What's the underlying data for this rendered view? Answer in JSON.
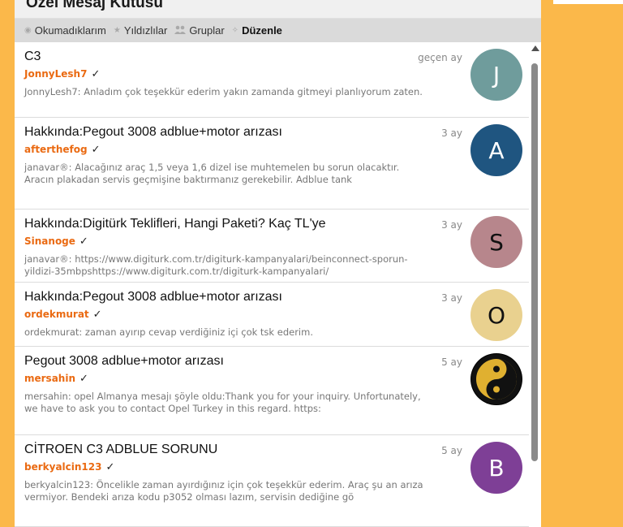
{
  "title": "Özel Mesaj Kutusu",
  "tabs": [
    {
      "label": "Okumadıklarım",
      "icon": "eye-icon"
    },
    {
      "label": "Yıldızlılar",
      "icon": "star-icon"
    },
    {
      "label": "Gruplar",
      "icon": "users-icon"
    },
    {
      "label": "Düzenle",
      "icon": "settings-icon",
      "active": true
    }
  ],
  "messages": [
    {
      "subject": "C3",
      "user": "JonnyLesh7",
      "preview": "JonnyLesh7: Anladım çok teşekkür ederim yakın zamanda gitmeyi planlıyorum zaten.",
      "time": "geçen ay",
      "avatar_letter": "J",
      "avatar_color": "#6f9c9c"
    },
    {
      "subject": "Hakkında:Pegout 3008 adblue+motor arızası",
      "user": "afterthefog",
      "preview": "janavar®: Alacağınız araç 1,5 veya 1,6 dizel ise muhtemelen bu sorun olacaktır. Aracın plakadan servis geçmişine baktırmanız gerekebilir. Adblue tank",
      "time": "3 ay",
      "avatar_letter": "A",
      "avatar_color": "#1f5580"
    },
    {
      "subject": "Hakkında:Digitürk Teklifleri, Hangi Paketi? Kaç TL'ye",
      "user": "Sinanoge",
      "preview": "janavar®: https://www.digiturk.com.tr/digiturk-kampanyalari/beinconnect-sporun-yildizi-35mbpshttps://www.digiturk.com.tr/digiturk-kampanyalari/",
      "time": "3 ay",
      "avatar_letter": "S",
      "avatar_color": "#b7868c"
    },
    {
      "subject": "Hakkında:Pegout 3008 adblue+motor arızası",
      "user": "ordekmurat",
      "preview": "ordekmurat: zaman ayırıp cevap verdiğiniz içi çok tsk ederim.",
      "time": "3 ay",
      "avatar_letter": "O",
      "avatar_color": "#e9d18f"
    },
    {
      "subject": "Pegout 3008 adblue+motor arızası",
      "user": "mersahin",
      "preview": "mersahin: opel Almanya mesajı şöyle oldu:Thank you for your inquiry. Unfortunately, we have to ask you to contact Opel Turkey in this regard. https:",
      "time": "5 ay",
      "avatar_letter": "",
      "avatar_color": "#000000"
    },
    {
      "subject": "CİTROEN C3 ADBLUE SORUNU",
      "user": "berkyalcin123",
      "preview": "berkyalcin123: Öncelikle zaman ayırdığınız için çok teşekkür ederim. Araç şu an arıza vermiyor. Bendeki arıza kodu p3052 olması lazım, servisin dediğine gö",
      "time": "5 ay",
      "avatar_letter": "B",
      "avatar_color": "#7e3f96"
    }
  ]
}
